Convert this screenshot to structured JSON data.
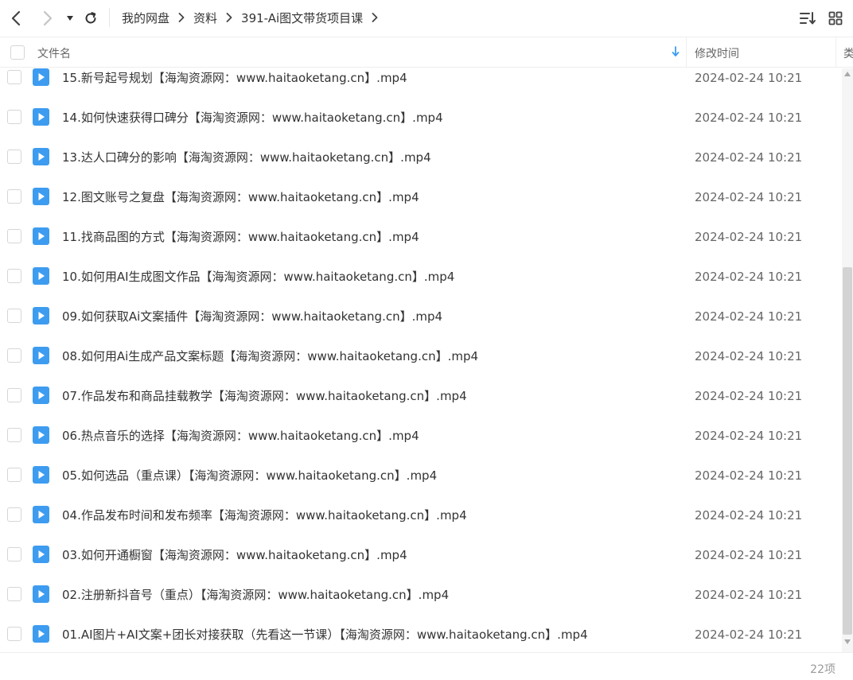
{
  "breadcrumb": [
    "我的网盘",
    "资料",
    "391-Ai图文带货项目课"
  ],
  "columns": {
    "name": "文件名",
    "modified": "修改时间",
    "type": "类"
  },
  "accent_color": "#3d9cf0",
  "files": [
    {
      "name": "15.新号起号规划【海淘资源网：www.haitaoketang.cn】.mp4",
      "modified": "2024-02-24 10:21"
    },
    {
      "name": "14.如何快速获得口碑分【海淘资源网：www.haitaoketang.cn】.mp4",
      "modified": "2024-02-24 10:21"
    },
    {
      "name": "13.达人口碑分的影响【海淘资源网：www.haitaoketang.cn】.mp4",
      "modified": "2024-02-24 10:21"
    },
    {
      "name": "12.图文账号之复盘【海淘资源网：www.haitaoketang.cn】.mp4",
      "modified": "2024-02-24 10:21"
    },
    {
      "name": "11.找商品图的方式【海淘资源网：www.haitaoketang.cn】.mp4",
      "modified": "2024-02-24 10:21"
    },
    {
      "name": "10.如何用AI生成图文作品【海淘资源网：www.haitaoketang.cn】.mp4",
      "modified": "2024-02-24 10:21"
    },
    {
      "name": "09.如何获取Ai文案插件【海淘资源网：www.haitaoketang.cn】.mp4",
      "modified": "2024-02-24 10:21"
    },
    {
      "name": "08.如何用Ai生成产品文案标题【海淘资源网：www.haitaoketang.cn】.mp4",
      "modified": "2024-02-24 10:21"
    },
    {
      "name": "07.作品发布和商品挂载教学【海淘资源网：www.haitaoketang.cn】.mp4",
      "modified": "2024-02-24 10:21"
    },
    {
      "name": "06.热点音乐的选择【海淘资源网：www.haitaoketang.cn】.mp4",
      "modified": "2024-02-24 10:21"
    },
    {
      "name": "05.如何选品（重点课）【海淘资源网：www.haitaoketang.cn】.mp4",
      "modified": "2024-02-24 10:21"
    },
    {
      "name": "04.作品发布时间和发布频率【海淘资源网：www.haitaoketang.cn】.mp4",
      "modified": "2024-02-24 10:21"
    },
    {
      "name": "03.如何开通橱窗【海淘资源网：www.haitaoketang.cn】.mp4",
      "modified": "2024-02-24 10:21"
    },
    {
      "name": "02.注册新抖音号（重点）【海淘资源网：www.haitaoketang.cn】.mp4",
      "modified": "2024-02-24 10:21"
    },
    {
      "name": "01.AI图片+AI文案+团长对接获取（先看这一节课）【海淘资源网：www.haitaoketang.cn】.mp4",
      "modified": "2024-02-24 10:21"
    }
  ],
  "footer": {
    "count": "22项"
  }
}
